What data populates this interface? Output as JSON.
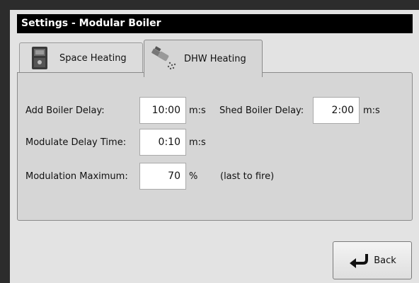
{
  "window": {
    "title": "Settings - Modular Boiler"
  },
  "tabs": [
    {
      "label": "Space Heating",
      "icon": "boiler-icon",
      "active": false
    },
    {
      "label": "DHW Heating",
      "icon": "faucet-icon",
      "active": true
    }
  ],
  "fields": {
    "add_boiler_delay": {
      "label": "Add Boiler Delay:",
      "value": "10:00",
      "unit": "m:s"
    },
    "shed_boiler_delay": {
      "label": "Shed Boiler Delay:",
      "value": "2:00",
      "unit": "m:s"
    },
    "modulate_delay_time": {
      "label": "Modulate Delay Time:",
      "value": "0:10",
      "unit": "m:s"
    },
    "modulation_maximum": {
      "label": "Modulation Maximum:",
      "value": "70",
      "unit": "%",
      "note": "(last to fire)"
    }
  },
  "back_button": {
    "label": "Back",
    "icon": "back-arrow-icon"
  }
}
